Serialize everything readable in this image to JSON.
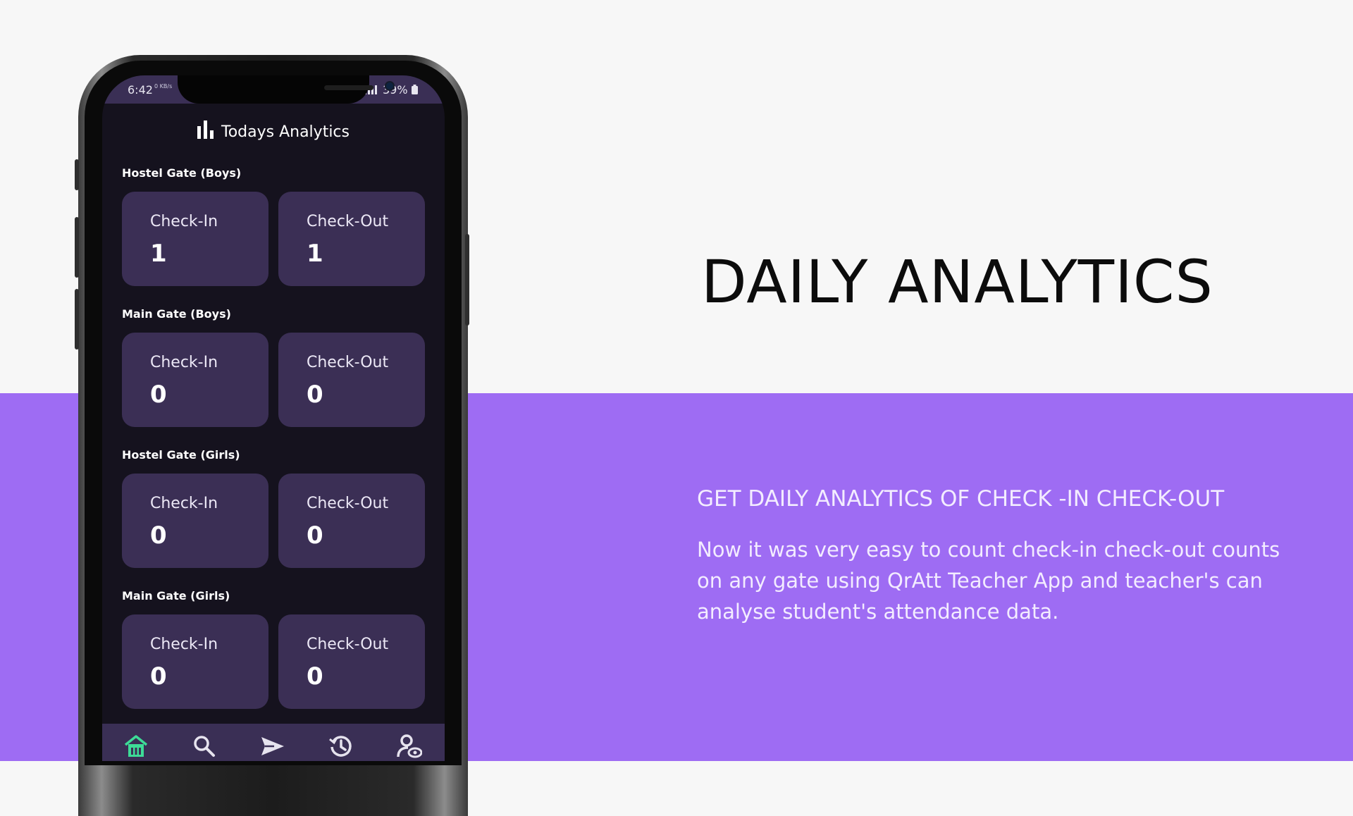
{
  "slide": {
    "headline": "DAILY ANALYTICS",
    "subheadline": "GET DAILY ANALYTICS OF CHECK -IN CHECK-OUT",
    "description": "Now it was very easy to count check-in check-out counts on any gate using QrAtt Teacher App and teacher's can analyse student's attendance data.",
    "colors": {
      "background": "#f7f7f7",
      "band": "#9e6cf3",
      "headline": "#0c0c0c",
      "band_text": "#f3ecff"
    }
  },
  "phone": {
    "status_bar": {
      "time": "6:42",
      "network_speed": "0 KB/s",
      "battery": "39%"
    },
    "app": {
      "title": "Todays Analytics",
      "title_icon": "bar-chart-icon",
      "colors": {
        "screen_bg": "#15121e",
        "card_bg": "#3b2f55",
        "nav_active": "#3ddc97",
        "nav_inactive": "#e6e3ee"
      },
      "sections": [
        {
          "name": "Hostel Gate (Boys)",
          "cards": [
            {
              "label": "Check-In",
              "value": "1"
            },
            {
              "label": "Check-Out",
              "value": "1"
            }
          ]
        },
        {
          "name": "Main Gate (Boys)",
          "cards": [
            {
              "label": "Check-In",
              "value": "0"
            },
            {
              "label": "Check-Out",
              "value": "0"
            }
          ]
        },
        {
          "name": "Hostel Gate (Girls)",
          "cards": [
            {
              "label": "Check-In",
              "value": "0"
            },
            {
              "label": "Check-Out",
              "value": "0"
            }
          ]
        },
        {
          "name": "Main Gate (Girls)",
          "cards": [
            {
              "label": "Check-In",
              "value": "0"
            },
            {
              "label": "Check-Out",
              "value": "0"
            }
          ]
        }
      ],
      "bottom_nav": [
        {
          "icon": "home-icon",
          "active": true
        },
        {
          "icon": "search-icon",
          "active": false
        },
        {
          "icon": "send-icon",
          "active": false
        },
        {
          "icon": "history-icon",
          "active": false
        },
        {
          "icon": "user-view-icon",
          "active": false
        }
      ]
    }
  }
}
